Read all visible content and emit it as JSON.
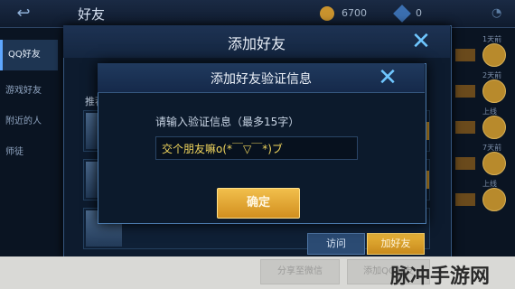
{
  "top_bar": {
    "back_icon": "back-arrow-icon",
    "title": "好友",
    "coin_value": "6700",
    "gem_value": "0"
  },
  "sidebar": {
    "items": [
      {
        "label": "QQ好友"
      },
      {
        "label": "游戏好友"
      },
      {
        "label": "附近的人"
      },
      {
        "label": "师徒"
      }
    ]
  },
  "right_list": {
    "texts": [
      "1天前",
      "2天前",
      "上线",
      "7天前",
      "上线"
    ]
  },
  "add_friend_dialog": {
    "title": "添加好友",
    "recommend_label": "推荐",
    "visit_label": "访问",
    "add_label": "加好友"
  },
  "verify_dialog": {
    "title": "添加好友验证信息",
    "input_label": "请输入验证信息（最多15字）",
    "input_value": "交个朋友嘛o(*￣▽￣*)ブ",
    "confirm_label": "确定"
  },
  "bottom_bar": {
    "share_label": "分享至微信",
    "qq_label": "添加QQ好友"
  },
  "watermark": "脉冲手游网",
  "colors": {
    "accent_gold": "#d89c2a",
    "accent_blue": "#6fc7ff",
    "input_text": "#f1d65d"
  }
}
